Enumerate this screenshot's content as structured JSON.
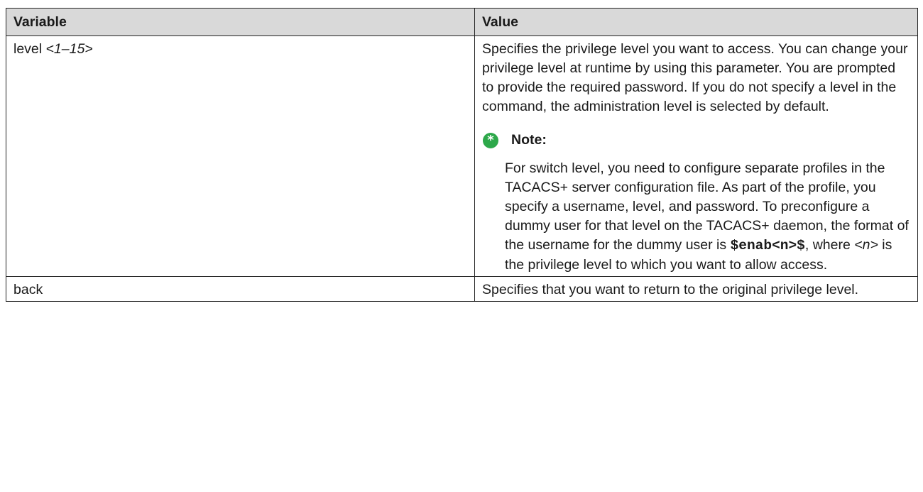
{
  "table": {
    "headers": {
      "variable": "Variable",
      "value": "Value"
    },
    "rows": [
      {
        "variable_name": "level",
        "variable_arg": "<1–15>",
        "value_text": "Specifies the privilege level you want to access. You can change your privilege level at runtime by using this parameter. You are prompted to provide the required password. If you do not specify a level in the command, the administration level is selected by default.",
        "note": {
          "label": "Note:",
          "text_part1": "For switch level, you need to configure separate profiles in the TACACS+ server configuration file. As part of the profile, you specify a username, level, and password. To preconfigure a dummy user for that level on the TACACS+ daemon, the format of the username for the dummy user is ",
          "code": "$enab<n>$",
          "text_part2": ", where ",
          "var": "<n>",
          "text_part3": " is the privilege level to which you want to allow access."
        }
      },
      {
        "variable_name": "back",
        "value_text": "Specifies that you want to return to the original privilege level."
      }
    ]
  },
  "note_icon": {
    "name": "asterisk-icon",
    "color": "#2da84a",
    "glyph": "*"
  }
}
